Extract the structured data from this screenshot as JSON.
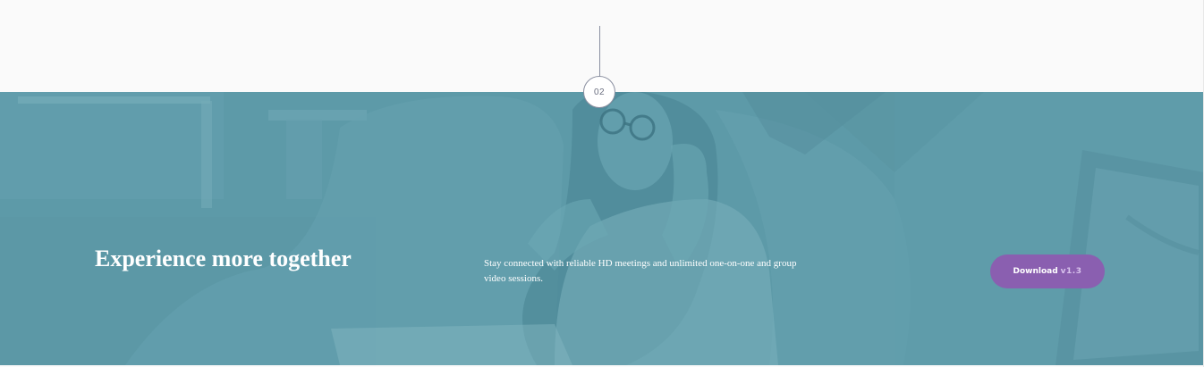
{
  "timeline": {
    "step_number": "02"
  },
  "hero": {
    "headline": "Experience more together",
    "description": "Stay connected with reliable HD meetings and unlimited one-on-one and group video sessions.",
    "download_label": "Download",
    "download_version": "v1.3",
    "overlay_color": "#5e9aa8",
    "button_color": "#8a5fb0"
  }
}
